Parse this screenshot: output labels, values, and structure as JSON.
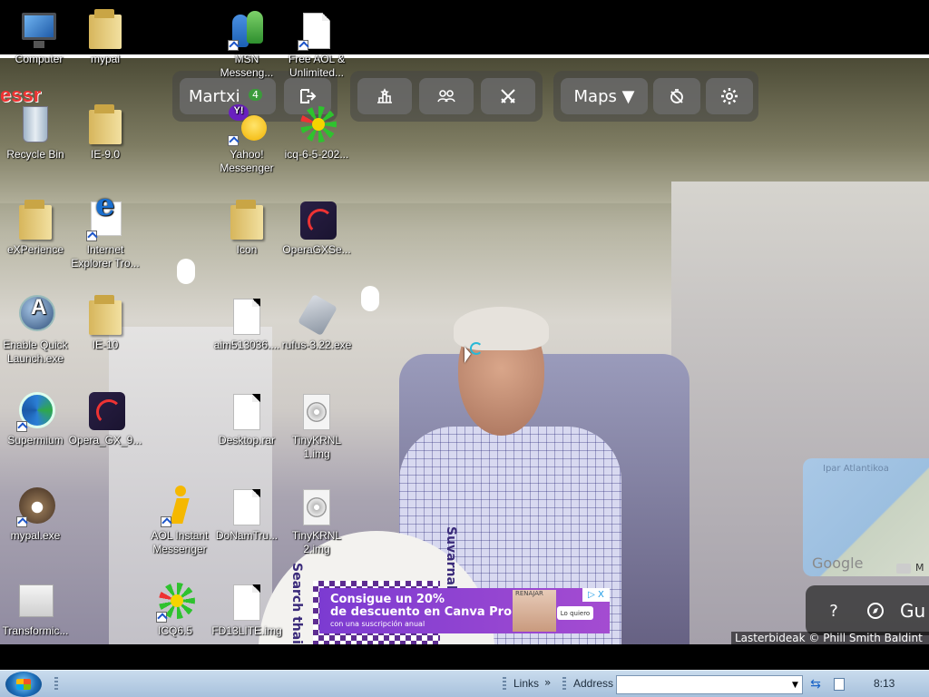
{
  "desktop_icons": [
    {
      "label": "Computer",
      "icon": "computer-icon",
      "shortcut": false
    },
    {
      "label": "mypal",
      "icon": "folder-icon",
      "shortcut": false
    },
    {
      "label": "MSN Messeng...",
      "icon": "msn-messenger-icon",
      "shortcut": true
    },
    {
      "label": "Free AOL & Unlimited...",
      "icon": "document-icon",
      "shortcut": true
    },
    {
      "label": "Recycle Bin",
      "icon": "recycle-bin-icon",
      "shortcut": false
    },
    {
      "label": "IE-9.0",
      "icon": "folder-icon",
      "shortcut": false
    },
    {
      "label": "Yahoo! Messenger",
      "icon": "yahoo-messenger-icon",
      "shortcut": true
    },
    {
      "label": "icq-6-5-202...",
      "icon": "icq-installer-icon",
      "shortcut": false
    },
    {
      "label": "eXPerience",
      "icon": "folder-icon",
      "shortcut": false
    },
    {
      "label": "Internet Explorer Tro...",
      "icon": "internet-explorer-icon",
      "shortcut": true
    },
    {
      "label": "Icon",
      "icon": "folder-icon",
      "shortcut": false
    },
    {
      "label": "OperaGXSe...",
      "icon": "opera-gx-icon",
      "shortcut": false
    },
    {
      "label": "Enable Quick Launch.exe",
      "icon": "quick-launch-icon",
      "shortcut": false
    },
    {
      "label": "IE-10",
      "icon": "folder-icon",
      "shortcut": false
    },
    {
      "label": "aim513036....",
      "icon": "document-icon",
      "shortcut": false
    },
    {
      "label": "rufus-3.22.exe",
      "icon": "rufus-icon",
      "shortcut": false
    },
    {
      "label": "Supermium",
      "icon": "supermium-icon",
      "shortcut": true
    },
    {
      "label": "Opera_GX_9...",
      "icon": "opera-gx-icon",
      "shortcut": false
    },
    {
      "label": "Desktop.rar",
      "icon": "document-icon",
      "shortcut": false
    },
    {
      "label": "TinyKRNL 1.img",
      "icon": "disc-image-icon",
      "shortcut": false
    },
    {
      "label": "mypal.exe",
      "icon": "mypal-icon",
      "shortcut": true
    },
    {
      "label": "AOL Instant Messenger",
      "icon": "aim-icon",
      "shortcut": true
    },
    {
      "label": "DoNamTru...",
      "icon": "document-icon",
      "shortcut": false
    },
    {
      "label": "TinyKRNL 2.img",
      "icon": "disc-image-icon",
      "shortcut": false
    },
    {
      "label": "Transformic...",
      "icon": "transformic-icon",
      "shortcut": false
    },
    {
      "label": "ICQ6.5",
      "icon": "icq-icon",
      "shortcut": true
    },
    {
      "label": "FD13LITE.img",
      "icon": "document-icon",
      "shortcut": false
    }
  ],
  "game_toolbar": {
    "player_name": "Martxi",
    "badge_count": "4",
    "maps_label": "Maps ▼",
    "icons": [
      "exit-icon",
      "leaderboard-icon",
      "party-icon",
      "duel-icon",
      "timer-off-icon",
      "settings-icon"
    ]
  },
  "minimap": {
    "ocean_label": "Ipar Atlantikoa",
    "google_label": "Google",
    "corner_label": "M"
  },
  "map_controls": {
    "help_label": "?",
    "compass_label": "◎",
    "guess_label": "Gu"
  },
  "attribution": {
    "text": "Lasterbideak   © Phill Smith   Baldint"
  },
  "ad": {
    "line1": "Consigue un 20%",
    "line2": "de descuento en Canva Pro",
    "line3": "con una suscripción anual",
    "thumb_label": "RENAJAR",
    "cta": "Lo quiero",
    "close": "▷ X"
  },
  "sign_text": {
    "left": "Search thaib",
    "right": "Suvarnab"
  },
  "overlay_text": {
    "essr": "essr"
  },
  "taskbar": {
    "links_label": "Links",
    "links_chevron": "»",
    "address_label": "Address",
    "address_value": "",
    "clock": "8:13"
  }
}
